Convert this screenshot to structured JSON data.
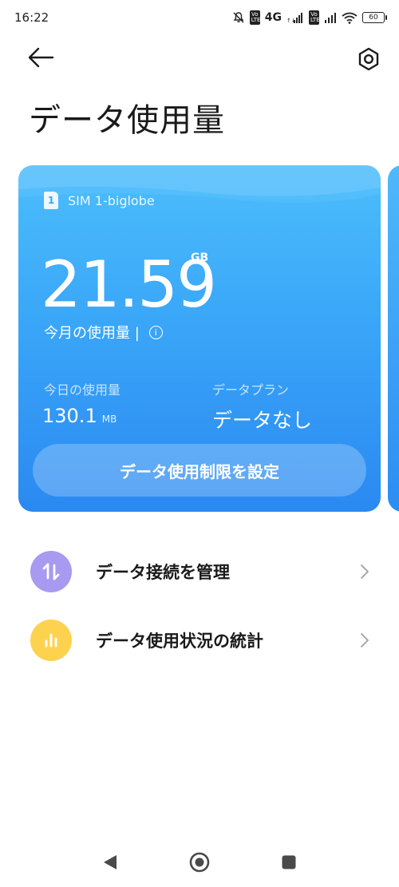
{
  "status_bar": {
    "time": "16:22",
    "network_type": "4G",
    "volte_label_1": "Vo LTE",
    "volte_label_2": "Vo LTE",
    "battery": "60"
  },
  "header": {
    "title": "データ使用量"
  },
  "sim_card": {
    "sim_label": "SIM 1-biglobe",
    "sim_slot": "1",
    "monthly_usage_value": "21.59",
    "monthly_usage_unit": "GB",
    "monthly_usage_label": "今月の使用量 |",
    "today_label": "今日の使用量",
    "today_value": "130.1",
    "today_unit": "MB",
    "plan_label": "データプラン",
    "plan_value": "データなし",
    "limit_button_label": "データ使用制限を設定"
  },
  "list": {
    "items": [
      {
        "label": "データ接続を管理",
        "icon": "data-transfer-icon",
        "color": "#a79af0"
      },
      {
        "label": "データ使用状況の統計",
        "icon": "bar-chart-icon",
        "color": "#fdd24f"
      }
    ]
  },
  "colors": {
    "card_top": "#4cbefc",
    "card_bottom": "#2a89f1"
  }
}
